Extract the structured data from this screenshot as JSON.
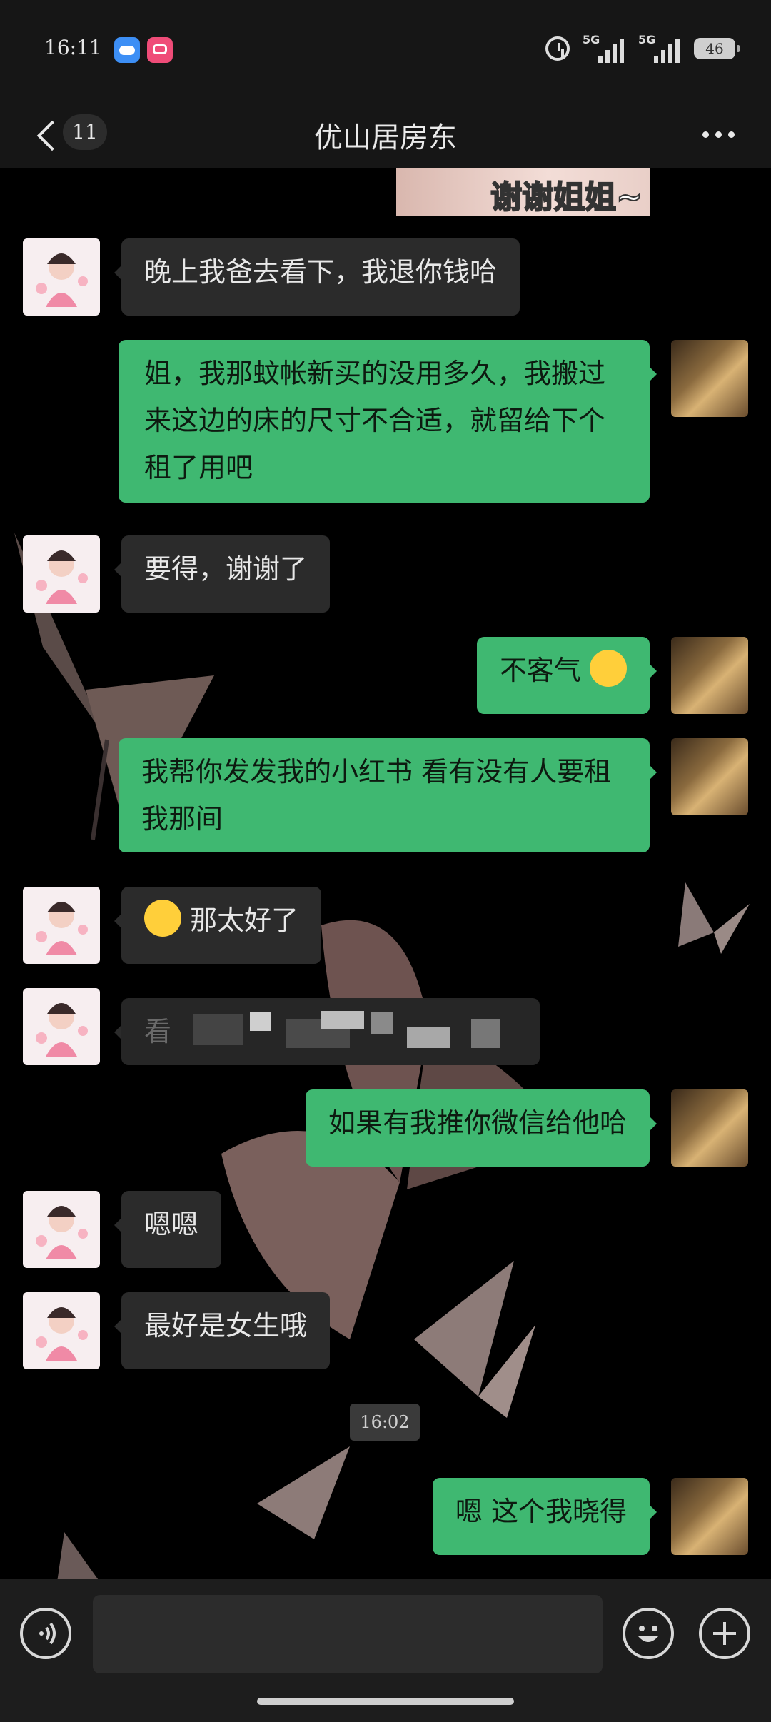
{
  "status_bar": {
    "time": "16:11",
    "network_1": "5G",
    "network_2": "5G",
    "battery": "46"
  },
  "header": {
    "unread_count": "11",
    "title": "优山居房东"
  },
  "chat": {
    "sticker_caption": "谢谢姐姐~",
    "messages": [
      {
        "side": "left",
        "text": "晚上我爸去看下，我退你钱哈"
      },
      {
        "side": "right",
        "text": "姐，我那蚊帐新买的没用多久，我搬过来这边的床的尺寸不合适，就留给下个租了用吧"
      },
      {
        "side": "left",
        "text": "要得，谢谢了"
      },
      {
        "side": "right",
        "text": "不客气"
      },
      {
        "side": "right",
        "text": "我帮你发发我的小红书 看有没有人要租我那间"
      },
      {
        "side": "left",
        "text": "那太好了"
      },
      {
        "side": "left",
        "text": "看"
      },
      {
        "side": "right",
        "text": "如果有我推你微信给他哈"
      },
      {
        "side": "left",
        "text": "嗯嗯"
      },
      {
        "side": "left",
        "text": "最好是女生哦"
      },
      {
        "side": "right",
        "text": "嗯 这个我晓得"
      }
    ],
    "timestamp": "16:02"
  },
  "input_bar": {
    "text": ""
  },
  "colors": {
    "outgoing_bubble": "#3fb871",
    "incoming_bubble": "#2b2b2b",
    "background": "#000000"
  }
}
